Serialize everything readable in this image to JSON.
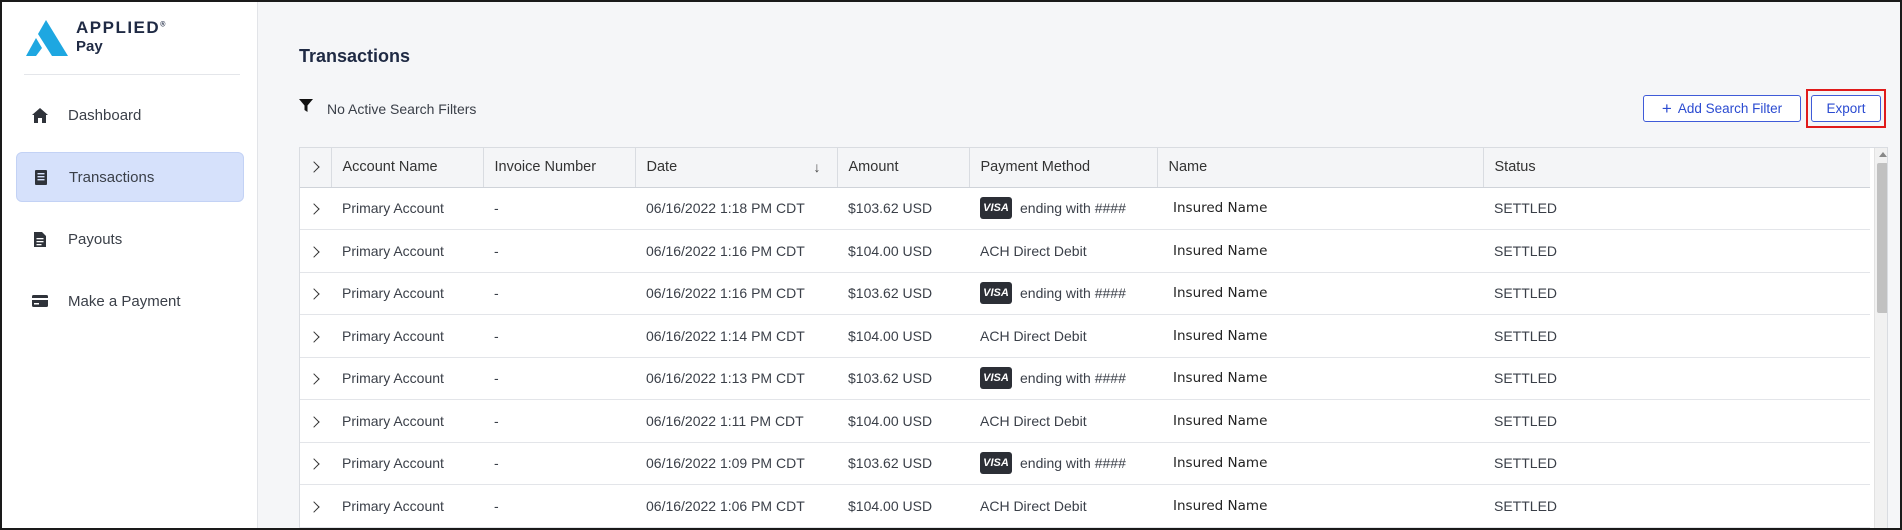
{
  "brand": {
    "name_top": "APPLIED",
    "trademark": "®",
    "name_bottom": "Pay",
    "colors": {
      "primary": "#2b4bd1",
      "logo_blue": "#1ea7e1",
      "highlight": "#e01b1b"
    }
  },
  "sidebar": {
    "items": [
      {
        "label": "Dashboard",
        "icon": "home-icon",
        "active": false
      },
      {
        "label": "Transactions",
        "icon": "receipt-icon",
        "active": true
      },
      {
        "label": "Payouts",
        "icon": "document-icon",
        "active": false
      },
      {
        "label": "Make a Payment",
        "icon": "credit-card-icon",
        "active": false
      }
    ]
  },
  "page": {
    "title": "Transactions",
    "filter_status": "No Active Search Filters",
    "add_filter_label": "Add Search Filter",
    "export_label": "Export"
  },
  "table": {
    "columns": [
      "Account Name",
      "Invoice Number",
      "Date",
      "Amount",
      "Payment Method",
      "Name",
      "Status"
    ],
    "sort_column": "Date",
    "sort_direction": "descending",
    "rows": [
      {
        "account": "Primary Account",
        "invoice": "-",
        "date": "06/16/2022 1:18 PM CDT",
        "amount": "$103.62 USD",
        "method_type": "card",
        "card_brand": "VISA",
        "method": "ending with ####",
        "name": "Insured Name",
        "status": "SETTLED"
      },
      {
        "account": "Primary Account",
        "invoice": "-",
        "date": "06/16/2022 1:16 PM CDT",
        "amount": "$104.00 USD",
        "method_type": "ach",
        "card_brand": "",
        "method": "ACH Direct Debit",
        "name": "Insured Name",
        "status": "SETTLED"
      },
      {
        "account": "Primary Account",
        "invoice": "-",
        "date": "06/16/2022 1:16 PM CDT",
        "amount": "$103.62 USD",
        "method_type": "card",
        "card_brand": "VISA",
        "method": "ending with ####",
        "name": "Insured Name",
        "status": "SETTLED"
      },
      {
        "account": "Primary Account",
        "invoice": "-",
        "date": "06/16/2022 1:14 PM CDT",
        "amount": "$104.00 USD",
        "method_type": "ach",
        "card_brand": "",
        "method": "ACH Direct Debit",
        "name": "Insured Name",
        "status": "SETTLED"
      },
      {
        "account": "Primary Account",
        "invoice": "-",
        "date": "06/16/2022 1:13 PM CDT",
        "amount": "$103.62 USD",
        "method_type": "card",
        "card_brand": "VISA",
        "method": "ending with ####",
        "name": "Insured Name",
        "status": "SETTLED"
      },
      {
        "account": "Primary Account",
        "invoice": "-",
        "date": "06/16/2022 1:11 PM CDT",
        "amount": "$104.00 USD",
        "method_type": "ach",
        "card_brand": "",
        "method": "ACH Direct Debit",
        "name": "Insured Name",
        "status": "SETTLED"
      },
      {
        "account": "Primary Account",
        "invoice": "-",
        "date": "06/16/2022 1:09 PM CDT",
        "amount": "$103.62 USD",
        "method_type": "card",
        "card_brand": "VISA",
        "method": "ending with ####",
        "name": "Insured Name",
        "status": "SETTLED"
      },
      {
        "account": "Primary Account",
        "invoice": "-",
        "date": "06/16/2022 1:06 PM CDT",
        "amount": "$104.00 USD",
        "method_type": "ach",
        "card_brand": "",
        "method": "ACH Direct Debit",
        "name": "Insured Name",
        "status": "SETTLED"
      }
    ]
  }
}
